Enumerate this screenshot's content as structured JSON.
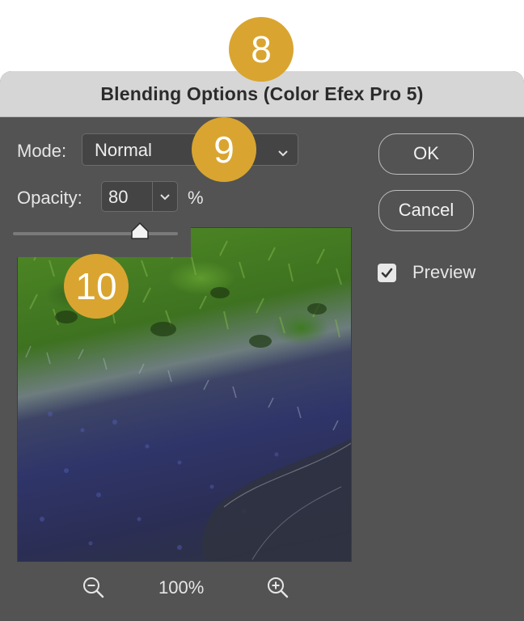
{
  "dialog": {
    "title": "Blending Options (Color Efex Pro 5)"
  },
  "mode": {
    "label": "Mode:",
    "value": "Normal"
  },
  "opacity": {
    "label": "Opacity:",
    "value": "80",
    "unit": "%",
    "slider_fraction": 0.8
  },
  "buttons": {
    "ok": "OK",
    "cancel": "Cancel"
  },
  "preview": {
    "label": "Preview",
    "checked": true
  },
  "zoom": {
    "value": "100%"
  },
  "badges": [
    "8",
    "9",
    "10"
  ],
  "colors": {
    "dialog_bg": "#535353",
    "titlebar_bg": "#d6d6d6",
    "badge": "#d9a530"
  },
  "icons": [
    "chevron-down-icon",
    "checkmark-icon",
    "zoom-out-icon",
    "zoom-in-icon",
    "slider-thumb-icon"
  ]
}
